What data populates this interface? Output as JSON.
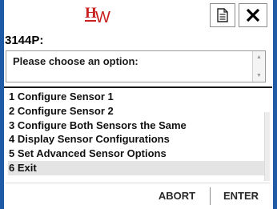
{
  "header": {
    "logo_icon": "hw-logo",
    "logo_letter_h": "H",
    "logo_letter_w": "W",
    "doc_button_icon": "document-icon",
    "close_button_icon": "close-icon",
    "device_tag": "3144P:"
  },
  "prompt": {
    "text": "Please choose an option:"
  },
  "menu": {
    "items": [
      {
        "label": "1 Configure Sensor 1"
      },
      {
        "label": "2 Configure Sensor 2"
      },
      {
        "label": "3 Configure Both Sensors the Same"
      },
      {
        "label": "4 Display Sensor Configurations"
      },
      {
        "label": "5 Set Advanced Sensor Options"
      },
      {
        "label": "6 Exit"
      }
    ],
    "selected_index": 5
  },
  "footer": {
    "abort_label": "ABORT",
    "enter_label": "ENTER"
  },
  "colors": {
    "frame_accent": "#1f5aa6",
    "logo_red": "#c8201e",
    "selected_row": "#e4e4e4"
  }
}
